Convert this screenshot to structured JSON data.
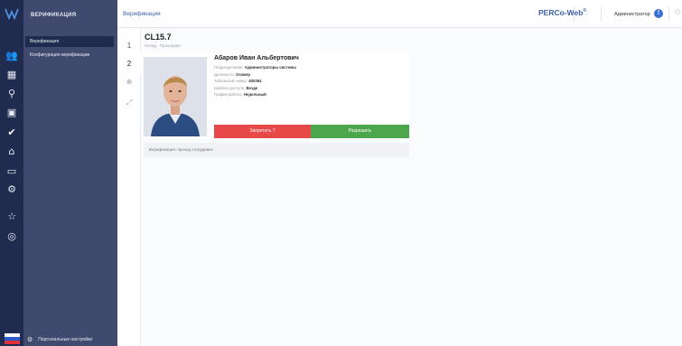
{
  "sidebar": {
    "section_title": "ВЕРИФИКАЦИЯ",
    "items": [
      {
        "label": "Верификация"
      },
      {
        "label": "Конфигурация верификации"
      }
    ],
    "footer_label": "Персональные настройки"
  },
  "header": {
    "page_title": "Верификация",
    "brand": "PERCo-Web",
    "brand_mark": "®",
    "user_label": "Администратор"
  },
  "tabs": [
    {
      "label": "1"
    },
    {
      "label": "2"
    }
  ],
  "device": {
    "title": "CL15.7",
    "subtitle": "Склад · Проходная"
  },
  "person": {
    "name": "Абаров Иван Альбертович",
    "fields": [
      {
        "label": "Подразделение:",
        "value": "Администраторы системы"
      },
      {
        "label": "Должность:",
        "value": "Оскжер"
      },
      {
        "label": "Табельный номер:",
        "value": "400354"
      },
      {
        "label": "Шаблон доступа:",
        "value": "Везде"
      },
      {
        "label": "График работы:",
        "value": "Недельный"
      }
    ]
  },
  "actions": {
    "deny_label": "Запретить 7",
    "allow_label": "Разрешить"
  },
  "status_text": "Верификация: проход сотрудника",
  "colors": {
    "iconbar_bg": "#1f2c4f",
    "sidebar_bg": "#3f4a6e",
    "accent_blue": "#3a5fa7",
    "deny_red": "#e74848",
    "allow_green": "#4ca64c"
  }
}
